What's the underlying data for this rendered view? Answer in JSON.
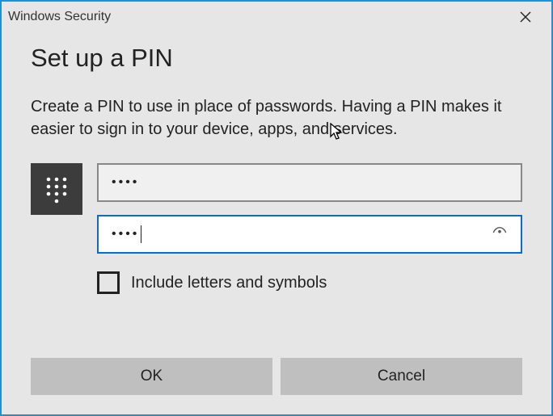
{
  "window": {
    "title": "Windows Security"
  },
  "heading": "Set up a PIN",
  "description": "Create a PIN to use in place of passwords. Having a PIN makes it easier to sign in to your device, apps, and services.",
  "fields": {
    "pin_value": "••••",
    "confirm_value": "••••"
  },
  "checkbox": {
    "label": "Include letters and symbols",
    "checked": false
  },
  "buttons": {
    "ok": "OK",
    "cancel": "Cancel"
  }
}
